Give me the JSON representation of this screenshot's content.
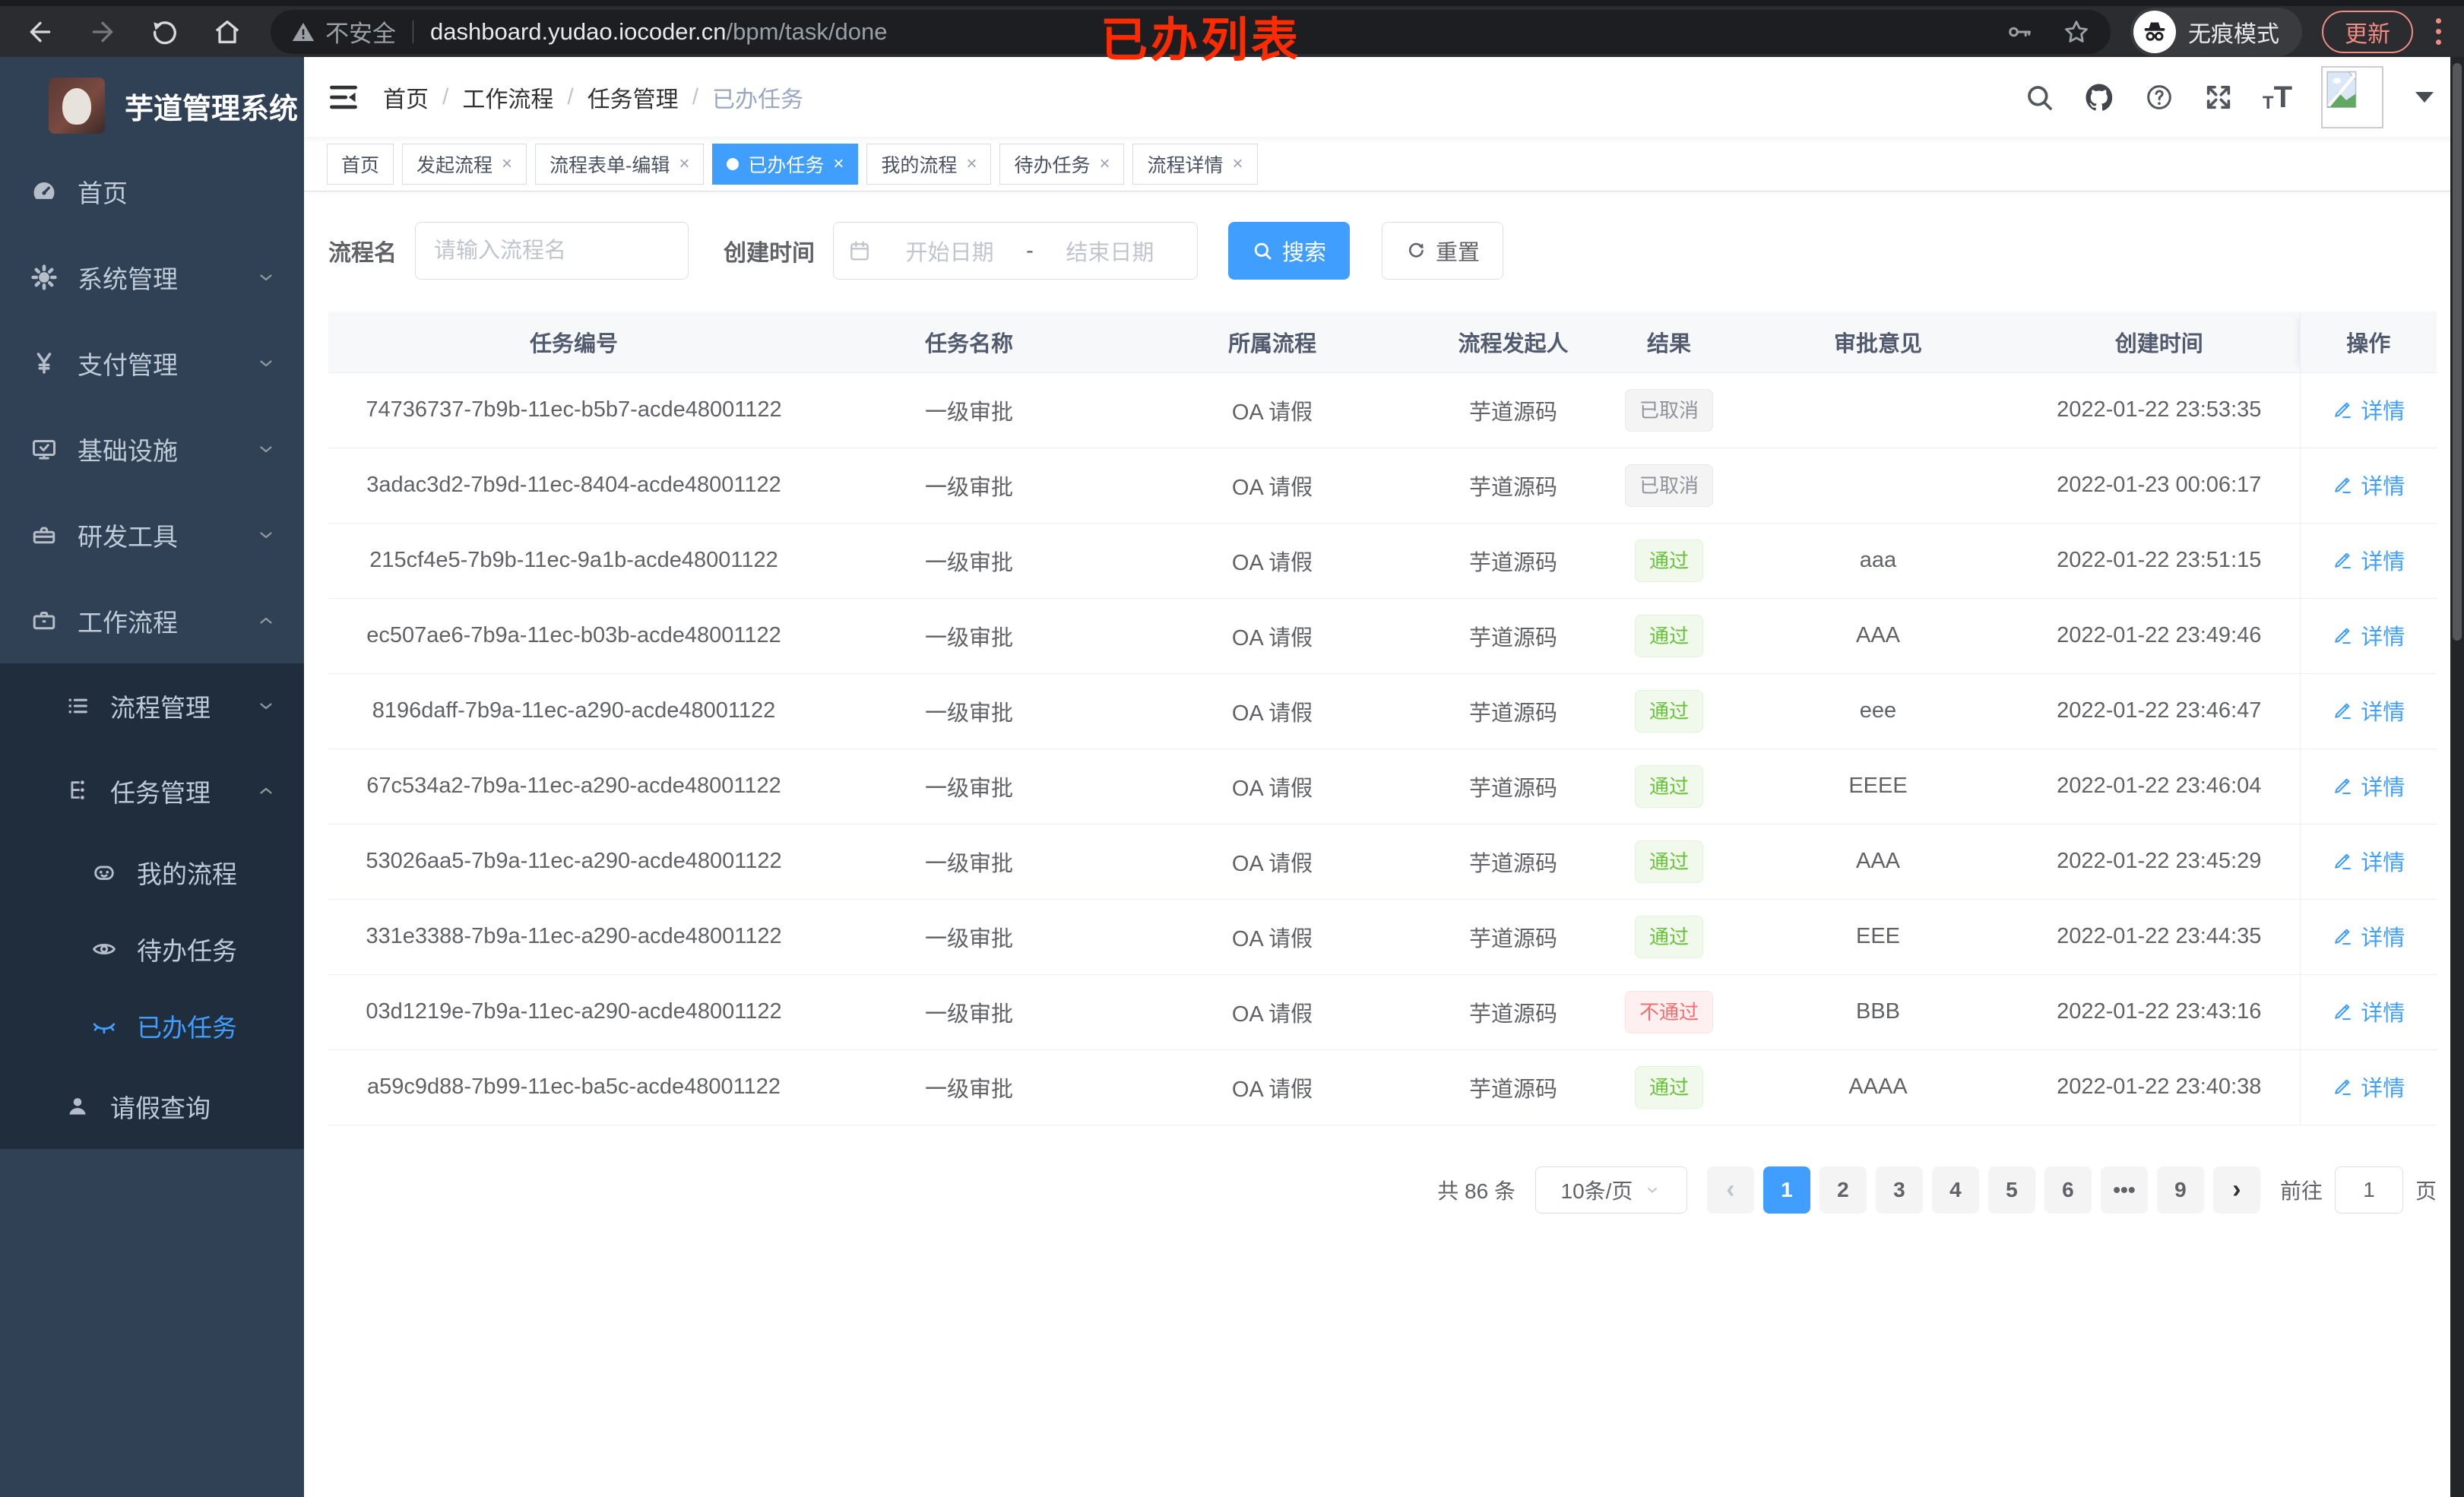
{
  "browser": {
    "security_label": "不安全",
    "url_host": "dashboard.yudao.iocoder.cn",
    "url_path": "/bpm/task/done",
    "incognito_label": "无痕模式",
    "update_label": "更新",
    "annotation": "已办列表"
  },
  "sidebar": {
    "app_title": "芋道管理系统",
    "items": [
      {
        "label": "首页",
        "icon": "dashboard",
        "cls": "lvl1"
      },
      {
        "label": "系统管理",
        "icon": "gear",
        "cls": "lvl1",
        "arrow": "down"
      },
      {
        "label": "支付管理",
        "icon": "yen",
        "cls": "lvl1",
        "arrow": "down"
      },
      {
        "label": "基础设施",
        "icon": "infra",
        "cls": "lvl1",
        "arrow": "down"
      },
      {
        "label": "研发工具",
        "icon": "tools",
        "cls": "lvl1",
        "arrow": "down"
      },
      {
        "label": "工作流程",
        "icon": "briefcase",
        "cls": "lvl1",
        "arrow": "up"
      },
      {
        "label": "流程管理",
        "icon": "list",
        "cls": "sub lvl2",
        "arrow": "down"
      },
      {
        "label": "任务管理",
        "icon": "tree",
        "cls": "sub lvl2",
        "arrow": "up"
      },
      {
        "label": "我的流程",
        "icon": "robot",
        "cls": "sub lvl3"
      },
      {
        "label": "待办任务",
        "icon": "eye",
        "cls": "sub lvl3"
      },
      {
        "label": "已办任务",
        "icon": "eyeclosed",
        "cls": "sub lvl3 is-active"
      },
      {
        "label": "请假查询",
        "icon": "user",
        "cls": "sub lvl2"
      }
    ]
  },
  "header": {
    "separator": "/",
    "breadcrumb": [
      {
        "label": "首页",
        "sep": "y"
      },
      {
        "label": "工作流程",
        "sep": "y"
      },
      {
        "label": "任务管理",
        "sep": "y"
      },
      {
        "label": "已办任务",
        "cls": "last"
      }
    ]
  },
  "tabs": {
    "close_glyph": "×",
    "items": [
      {
        "label": "首页"
      },
      {
        "label": "发起流程",
        "closable": "y"
      },
      {
        "label": "流程表单-编辑",
        "closable": "y"
      },
      {
        "label": "已办任务",
        "closable": "y",
        "active": "active"
      },
      {
        "label": "我的流程",
        "closable": "y"
      },
      {
        "label": "待办任务",
        "closable": "y"
      },
      {
        "label": "流程详情",
        "closable": "y"
      }
    ]
  },
  "filters": {
    "process_name_label": "流程名",
    "process_name_placeholder": "请输入流程名",
    "create_time_label": "创建时间",
    "date_start_placeholder": "开始日期",
    "date_separator": "-",
    "date_end_placeholder": "结束日期",
    "search_label": "搜索",
    "reset_label": "重置"
  },
  "table": {
    "columns": [
      "任务编号",
      "任务名称",
      "所属流程",
      "流程发起人",
      "结果",
      "审批意见",
      "创建时间",
      "操作"
    ],
    "detail_label": "详情",
    "rows": [
      {
        "id": "74736737-7b9b-11ec-b5b7-acde48001122",
        "name": "一级审批",
        "process": "OA 请假",
        "starter": "芋道源码",
        "result": "已取消",
        "result_type": "info",
        "opinion": "",
        "created": "2022-01-22 23:53:35"
      },
      {
        "id": "3adac3d2-7b9d-11ec-8404-acde48001122",
        "name": "一级审批",
        "process": "OA 请假",
        "starter": "芋道源码",
        "result": "已取消",
        "result_type": "info",
        "opinion": "",
        "created": "2022-01-23 00:06:17"
      },
      {
        "id": "215cf4e5-7b9b-11ec-9a1b-acde48001122",
        "name": "一级审批",
        "process": "OA 请假",
        "starter": "芋道源码",
        "result": "通过",
        "result_type": "success",
        "opinion": "aaa",
        "created": "2022-01-22 23:51:15"
      },
      {
        "id": "ec507ae6-7b9a-11ec-b03b-acde48001122",
        "name": "一级审批",
        "process": "OA 请假",
        "starter": "芋道源码",
        "result": "通过",
        "result_type": "success",
        "opinion": "AAA",
        "created": "2022-01-22 23:49:46"
      },
      {
        "id": "8196daff-7b9a-11ec-a290-acde48001122",
        "name": "一级审批",
        "process": "OA 请假",
        "starter": "芋道源码",
        "result": "通过",
        "result_type": "success",
        "opinion": "eee",
        "created": "2022-01-22 23:46:47"
      },
      {
        "id": "67c534a2-7b9a-11ec-a290-acde48001122",
        "name": "一级审批",
        "process": "OA 请假",
        "starter": "芋道源码",
        "result": "通过",
        "result_type": "success",
        "opinion": "EEEE",
        "created": "2022-01-22 23:46:04"
      },
      {
        "id": "53026aa5-7b9a-11ec-a290-acde48001122",
        "name": "一级审批",
        "process": "OA 请假",
        "starter": "芋道源码",
        "result": "通过",
        "result_type": "success",
        "opinion": "AAA",
        "created": "2022-01-22 23:45:29"
      },
      {
        "id": "331e3388-7b9a-11ec-a290-acde48001122",
        "name": "一级审批",
        "process": "OA 请假",
        "starter": "芋道源码",
        "result": "通过",
        "result_type": "success",
        "opinion": "EEE",
        "created": "2022-01-22 23:44:35"
      },
      {
        "id": "03d1219e-7b9a-11ec-a290-acde48001122",
        "name": "一级审批",
        "process": "OA 请假",
        "starter": "芋道源码",
        "result": "不通过",
        "result_type": "danger",
        "opinion": "BBB",
        "created": "2022-01-22 23:43:16"
      },
      {
        "id": "a59c9d88-7b99-11ec-ba5c-acde48001122",
        "name": "一级审批",
        "process": "OA 请假",
        "starter": "芋道源码",
        "result": "通过",
        "result_type": "success",
        "opinion": "AAAA",
        "created": "2022-01-22 23:40:38"
      }
    ]
  },
  "pagination": {
    "total_label": "共 86 条",
    "page_size": "10条/页",
    "prev_glyph": "‹",
    "next_glyph": "›",
    "pages": [
      {
        "label": "1",
        "cls": "active"
      },
      {
        "label": "2"
      },
      {
        "label": "3"
      },
      {
        "label": "4"
      },
      {
        "label": "5"
      },
      {
        "label": "6"
      },
      {
        "label": "•••"
      },
      {
        "label": "9"
      }
    ],
    "goto_label": "前往",
    "goto_value": "1",
    "page_unit": "页"
  }
}
